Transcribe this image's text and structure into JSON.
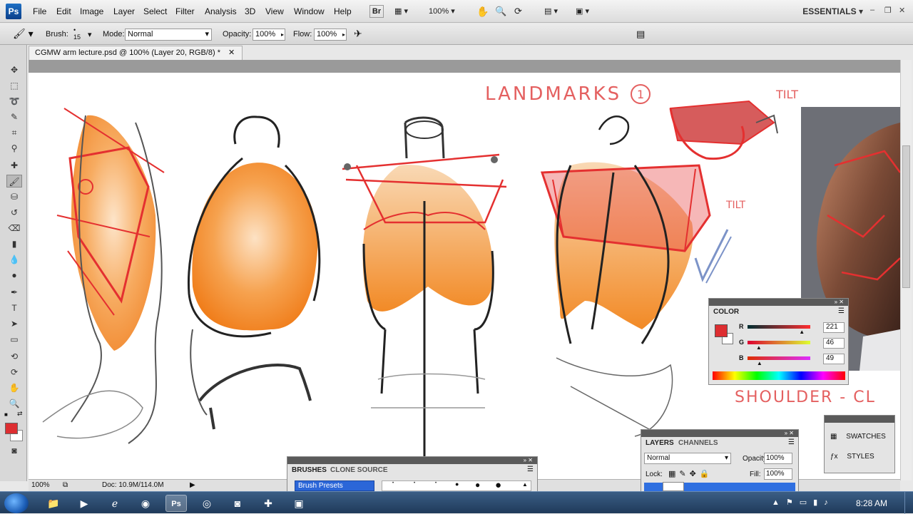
{
  "app": {
    "logo": "Ps",
    "workspace": "ESSENTIALS"
  },
  "menu": [
    "File",
    "Edit",
    "Image",
    "Layer",
    "Select",
    "Filter",
    "Analysis",
    "3D",
    "View",
    "Window",
    "Help"
  ],
  "menubar": {
    "bridge_label": "Br",
    "zoom": "100%"
  },
  "options": {
    "brush_label": "Brush:",
    "brush_size": "15",
    "mode_label": "Mode:",
    "mode_value": "Normal",
    "opacity_label": "Opacity:",
    "opacity_value": "100%",
    "flow_label": "Flow:",
    "flow_value": "100%"
  },
  "document": {
    "tab_title": "CGMW arm lecture.psd @ 100% (Layer 20, RGB/8) *",
    "zoom": "100%",
    "doc_info": "Doc: 10.9M/114.0M"
  },
  "sketch": {
    "landmarks_text": "LANDMARKS",
    "landmarks_num": "1",
    "tilt_top": "TILT",
    "tilt_mid": "TILT",
    "shoulder_text": "SHOULDER - CL"
  },
  "color_panel": {
    "title": "COLOR",
    "r_label": "R",
    "r_value": "221",
    "g_label": "G",
    "g_value": "46",
    "b_label": "B",
    "b_value": "49",
    "swatch": "#dd2e31",
    "r_level": 0.867,
    "g_level": 0.18,
    "b_level": 0.192
  },
  "brushes_panel": {
    "tab_brushes": "BRUSHES",
    "tab_clone": "CLONE SOURCE",
    "presets_label": "Brush Presets"
  },
  "layers_panel": {
    "tab_layers": "LAYERS",
    "tab_channels": "CHANNELS",
    "blend_mode": "Normal",
    "opacity_label": "Opacity:",
    "opacity_value": "100%",
    "lock_label": "Lock:",
    "fill_label": "Fill:",
    "fill_value": "100%"
  },
  "side_panels": {
    "swatches": "SWATCHES",
    "styles": "STYLES"
  },
  "taskbar": {
    "time": "8:28 AM"
  },
  "colors": {
    "foreground": "#dd2e31",
    "background": "#ffffff",
    "accent_blue": "#1e6fd9"
  }
}
